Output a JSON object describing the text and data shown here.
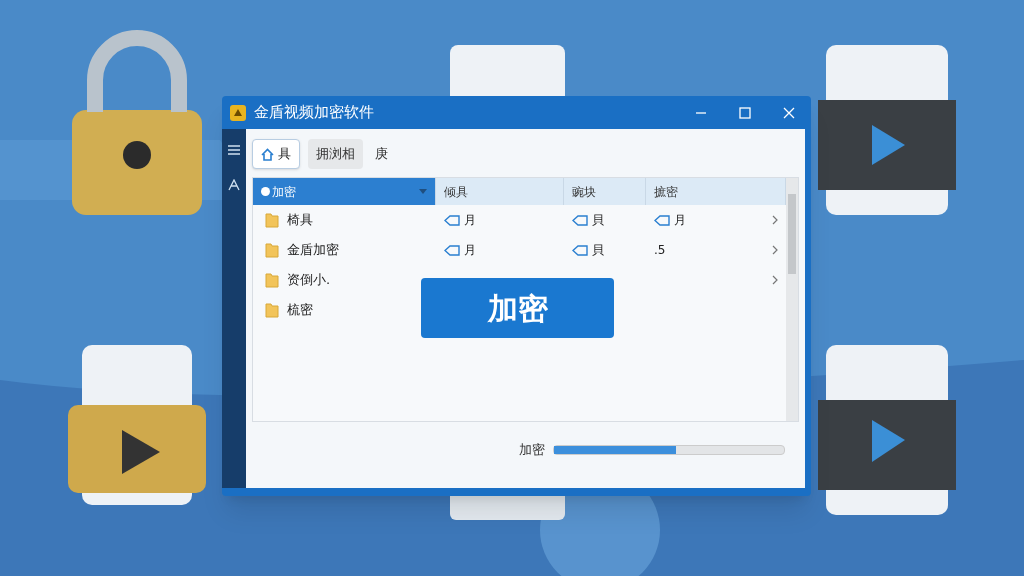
{
  "window": {
    "title": "金盾视频加密软件"
  },
  "tabs": [
    {
      "label": "具",
      "selected": true
    },
    {
      "label": "拥浏相",
      "selected": false
    },
    {
      "label": "庚",
      "selected": false
    }
  ],
  "table": {
    "columns": [
      {
        "label": "加密",
        "selected": true
      },
      {
        "label": "倾具",
        "selected": false
      },
      {
        "label": "豌块",
        "selected": false
      },
      {
        "label": "摭密",
        "selected": false
      }
    ],
    "rows": [
      {
        "cells": [
          "椅具",
          "月",
          "貝",
          "月"
        ],
        "expandable": true
      },
      {
        "cells": [
          "金盾加密",
          "月",
          "貝",
          ".5"
        ],
        "expandable": true
      },
      {
        "cells": [
          "资倒小."
        ],
        "expandable": true
      },
      {
        "cells": [
          "梳密"
        ],
        "expandable": false
      }
    ]
  },
  "encrypt_button": "加密",
  "progress": {
    "label": "加密",
    "level": 0.53
  }
}
